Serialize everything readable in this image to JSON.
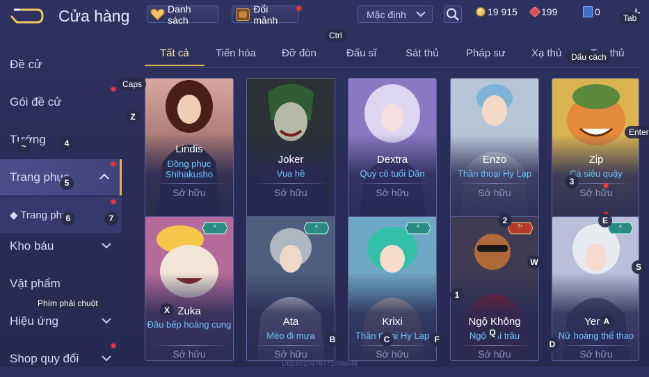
{
  "header": {
    "title": "Cửa hàng",
    "list_button": "Danh sách",
    "exchange_button": "Đổi mảnh",
    "sort_value": "Mặc định",
    "currencies": [
      {
        "icon": "gold-coin-icon",
        "value": "19 915"
      },
      {
        "icon": "red-voucher-icon",
        "value": "199"
      },
      {
        "icon": "blue-ticket-icon",
        "value": "0"
      }
    ]
  },
  "sidebar": {
    "items": [
      {
        "label": "Đề cử"
      },
      {
        "label": "Gói đề cử"
      },
      {
        "label": "Tướng"
      },
      {
        "label": "Trang phục"
      },
      {
        "label": "◆ Trang phục"
      },
      {
        "label": "Kho báu"
      },
      {
        "label": "Vật phẩm"
      },
      {
        "label": "Hiệu ứng"
      },
      {
        "label": "Shop quy đổi"
      }
    ]
  },
  "tabs": [
    "Tất cả",
    "Tiến hóa",
    "Đỡ đòn",
    "Đấu sĩ",
    "Sát thủ",
    "Pháp sư",
    "Xạ thủ",
    "Trợ thủ"
  ],
  "cards": [
    {
      "hero": "Lindis",
      "skin": "Đồng phục Shihakusho",
      "status": "Sở hữu"
    },
    {
      "hero": "Joker",
      "skin": "Vua hề",
      "status": "Sở hữu"
    },
    {
      "hero": "Dextra",
      "skin": "Quý cô tuổi Dần",
      "status": "Sở hữu"
    },
    {
      "hero": "Enzo",
      "skin": "Thần thoại Hy Lạp",
      "status": "Sở hữu"
    },
    {
      "hero": "Zip",
      "skin": "Cá siêu quậy",
      "status": "Sở hữu"
    },
    {
      "hero": "Zuka",
      "skin": "Đầu bếp hoàng cung",
      "status": "Sở hữu",
      "badge": "A HỮU HẠN"
    },
    {
      "hero": "Ata",
      "skin": "Mèo đi mưa",
      "status": "Sở hữu",
      "badge": "A HỮU HẠN"
    },
    {
      "hero": "Krixi",
      "skin": "Thần thoại Hy Lạp",
      "status": "Sở hữu",
      "badge": "A HỮU HẠN"
    },
    {
      "hero": "Ngộ Không",
      "skin": "Ngộ Khỉ trầu",
      "status": "Sở hữu",
      "badge": "S+ HỮU HẠN"
    },
    {
      "hero": "Yena",
      "skin": "Nữ hoàng thể thao",
      "status": "Sở hữu",
      "badge": "A HỮU HẠN"
    }
  ],
  "key_hints": {
    "tab": "Tab",
    "ctrl": "Ctrl",
    "caps": "Caps",
    "space": "Dấu cách",
    "enter": "Enter",
    "right_click": "Phím phải chuột",
    "z": "Z",
    "tilde": "~",
    "n4": "4",
    "n5": "5",
    "n6": "6",
    "n7": "7",
    "n3": "3",
    "n2": "2",
    "n1": "1",
    "e": "E",
    "w": "W",
    "s": "S",
    "x": "X",
    "a": "A",
    "b": "B",
    "c": "C",
    "f": "F",
    "q": "Q",
    "d": "D"
  },
  "footer": {
    "uid": "UID:6027676771066649"
  }
}
